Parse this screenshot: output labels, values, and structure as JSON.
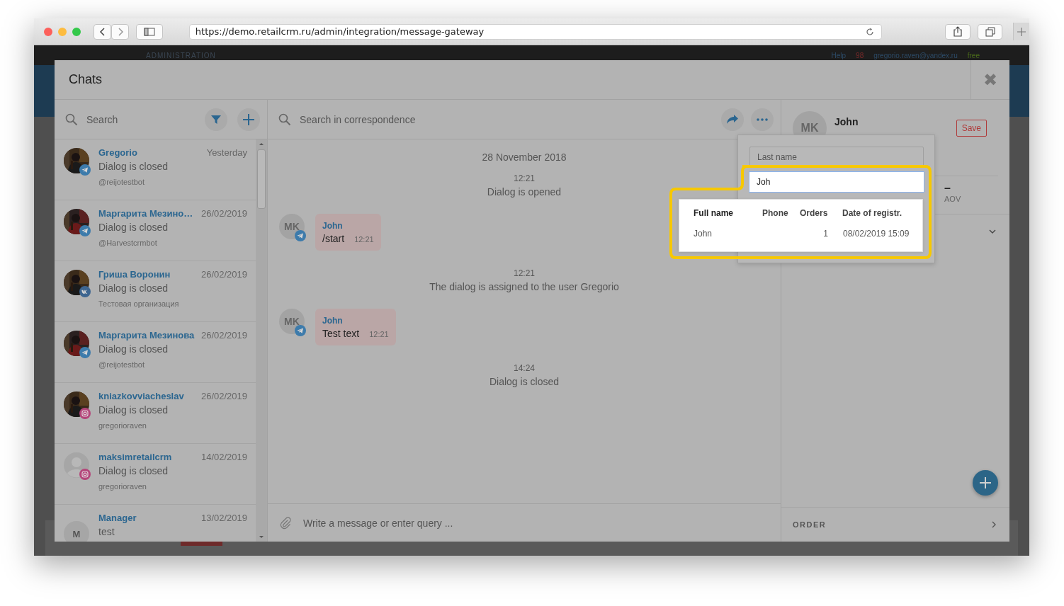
{
  "browser": {
    "url": "https://demo.retailcrm.ru/admin/integration/message-gateway"
  },
  "background_app": {
    "section": "ADMINISTRATION",
    "help": "Help",
    "notifications": "98",
    "user": "gregorio.raven@yandex.ru",
    "plan": "free"
  },
  "modal": {
    "title": "Chats",
    "close": "✖"
  },
  "chat_list": {
    "search_placeholder": "Search",
    "items": [
      {
        "name": "Gregorio",
        "time": "Yesterday",
        "status": "Dialog is closed",
        "source": "@reijotestbot",
        "badge": {
          "kind": "telegram"
        }
      },
      {
        "name": "Маргарита Мезино…",
        "time": "26/02/2019",
        "status": "Dialog is closed",
        "source": "@Harvestcrmbot",
        "badge": {
          "kind": "telegram"
        }
      },
      {
        "name": "Гриша Воронин",
        "time": "26/02/2019",
        "status": "Dialog is closed",
        "source": "Тестовая организация",
        "badge": {
          "kind": "vk"
        }
      },
      {
        "name": "Маргарита Мезинова",
        "time": "26/02/2019",
        "status": "Dialog is closed",
        "source": "@reijotestbot",
        "badge": {
          "kind": "telegram"
        }
      },
      {
        "name": "kniazkovviacheslav",
        "time": "26/02/2019",
        "status": "Dialog is closed",
        "source": "gregorioraven",
        "badge": {
          "kind": "instagram"
        }
      },
      {
        "kind": "placeholder",
        "name": "maksimretailcrm",
        "time": "14/02/2019",
        "status": "Dialog is closed",
        "source": "gregorioraven",
        "badge": {
          "kind": "instagram"
        }
      },
      {
        "kind": "initial",
        "initial": "M",
        "name": "Manager",
        "time": "13/02/2019",
        "status": "test"
      }
    ]
  },
  "conversation": {
    "search_placeholder": "Search in correspondence",
    "events": [
      {
        "kind": "date",
        "text": "28 November 2018"
      },
      {
        "kind": "system",
        "time": "12:21",
        "text": "Dialog is opened"
      },
      {
        "kind": "message",
        "initials": "MK",
        "author": "John",
        "text": "/start",
        "time": "12:21",
        "badge": {
          "kind": "telegram"
        }
      },
      {
        "kind": "system",
        "time": "12:21",
        "text": "The dialog is assigned to the user Gregorio"
      },
      {
        "kind": "message",
        "initials": "MK",
        "author": "John",
        "text": "Test text",
        "time": "12:21",
        "badge": {
          "kind": "telegram"
        }
      },
      {
        "kind": "system",
        "time": "14:24",
        "text": "Dialog is closed"
      }
    ],
    "composer_placeholder": "Write a message or enter query ..."
  },
  "customer": {
    "initials": "MK",
    "name": "John",
    "save": "Save",
    "stat_value": "–",
    "stat_label": "AOV",
    "section": "ORDER"
  },
  "customer_search": {
    "last_name_placeholder": "Last name",
    "query": "Joh",
    "columns": [
      "Full name",
      "Phone",
      "Orders",
      "Date of registr."
    ],
    "rows": [
      {
        "full_name": "John",
        "orders": "1",
        "registered": "08/02/2019 15:09"
      }
    ]
  }
}
